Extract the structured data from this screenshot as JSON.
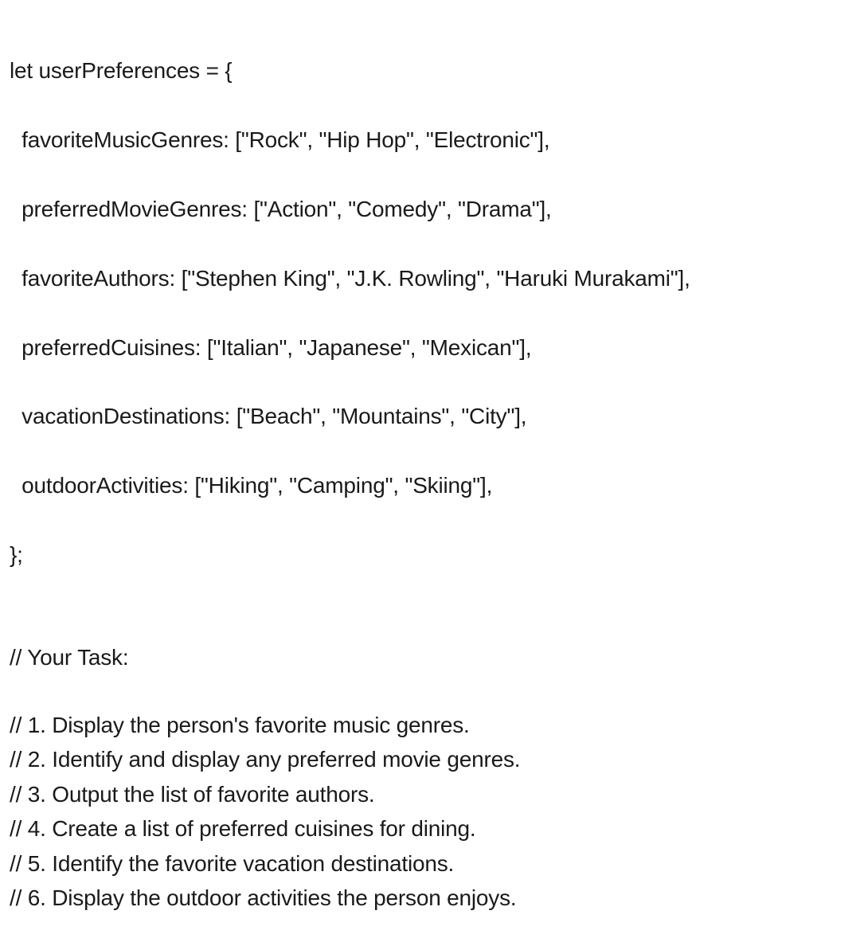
{
  "code": {
    "l1": "let userPreferences = {",
    "l2": "  favoriteMusicGenres: [\"Rock\", \"Hip Hop\", \"Electronic\"],",
    "l3": "  preferredMovieGenres: [\"Action\", \"Comedy\", \"Drama\"],",
    "l4": "  favoriteAuthors: [\"Stephen King\", \"J.K. Rowling\", \"Haruki Murakami\"],",
    "l5": "  preferredCuisines: [\"Italian\", \"Japanese\", \"Mexican\"],",
    "l6": "  vacationDestinations: [\"Beach\", \"Mountains\", \"City\"],",
    "l7": "  outdoorActivities: [\"Hiking\", \"Camping\", \"Skiing\"],",
    "l8": "};"
  },
  "task_header": "// Your Task:",
  "tasks": {
    "t1": "// 1. Display the person's favorite music genres.",
    "t2": "// 2. Identify and display any preferred movie genres.",
    "t3": "// 3. Output the list of favorite authors.",
    "t4": "// 4. Create a list of preferred cuisines for dining.",
    "t5": "// 5. Identify the favorite vacation destinations.",
    "t6": "// 6. Display the outdoor activities the person enjoys."
  }
}
